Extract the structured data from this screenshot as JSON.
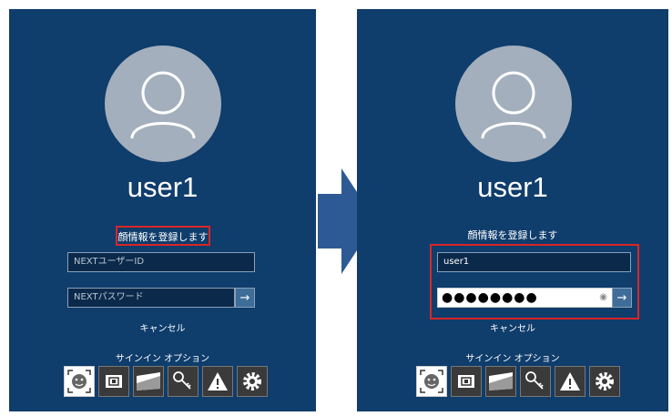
{
  "left": {
    "username": "user1",
    "register_text": "顔情報を登録します",
    "userid_placeholder": "NEXTユーザーID",
    "password_placeholder": "NEXTパスワード",
    "submit_glyph": "→",
    "cancel": "キャンセル",
    "signin_options": "サインイン オプション"
  },
  "right": {
    "username": "user1",
    "register_text": "顔情報を登録します",
    "userid_value": "user1",
    "password_masked": "●●●●●●●●",
    "submit_glyph": "→",
    "cancel": "キャンセル",
    "signin_options": "サインイン オプション"
  },
  "signin_option_icons": [
    "face-recognition-icon",
    "pin-keypad-icon",
    "security-card-icon",
    "key-icon",
    "warning-icon",
    "gear-icon"
  ],
  "colors": {
    "panel_bg": "#0f3d6c",
    "highlight": "#d92626",
    "arrow": "#2d5a94"
  }
}
